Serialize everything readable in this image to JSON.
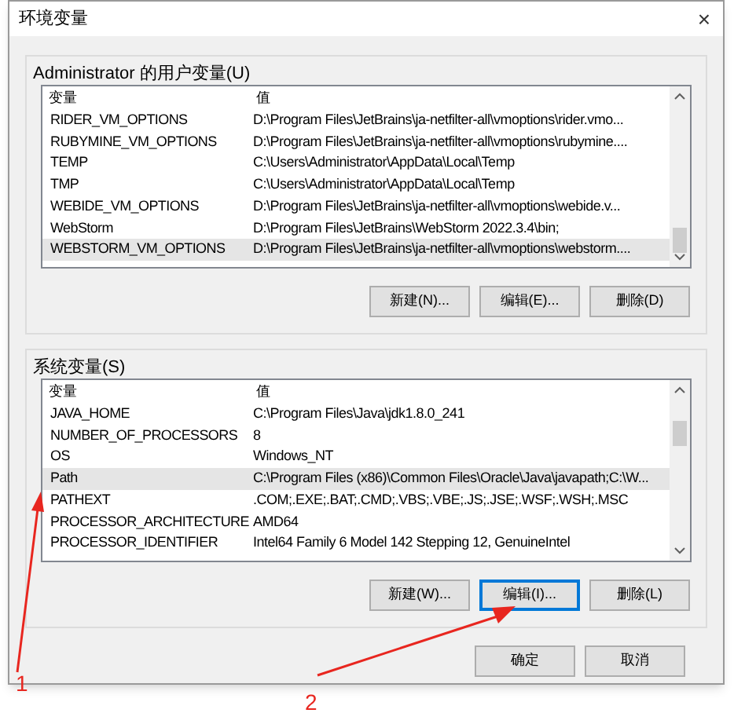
{
  "window": {
    "title": "环境变量",
    "close": "×"
  },
  "user_vars": {
    "label": "Administrator 的用户变量(U)",
    "columns": [
      "变量",
      "值"
    ],
    "rows": [
      {
        "name": "RIDER_VM_OPTIONS",
        "value": "D:\\Program Files\\JetBrains\\ja-netfilter-all\\vmoptions\\rider.vmo...",
        "selected": false
      },
      {
        "name": "RUBYMINE_VM_OPTIONS",
        "value": "D:\\Program Files\\JetBrains\\ja-netfilter-all\\vmoptions\\rubymine....",
        "selected": false
      },
      {
        "name": "TEMP",
        "value": "C:\\Users\\Administrator\\AppData\\Local\\Temp",
        "selected": false
      },
      {
        "name": "TMP",
        "value": "C:\\Users\\Administrator\\AppData\\Local\\Temp",
        "selected": false
      },
      {
        "name": "WEBIDE_VM_OPTIONS",
        "value": "D:\\Program Files\\JetBrains\\ja-netfilter-all\\vmoptions\\webide.v...",
        "selected": false
      },
      {
        "name": "WebStorm",
        "value": "D:\\Program Files\\JetBrains\\WebStorm 2022.3.4\\bin;",
        "selected": false
      },
      {
        "name": "WEBSTORM_VM_OPTIONS",
        "value": "D:\\Program Files\\JetBrains\\ja-netfilter-all\\vmoptions\\webstorm....",
        "selected": true
      }
    ],
    "buttons": [
      {
        "label": "新建(N)...",
        "focused": false
      },
      {
        "label": "编辑(E)...",
        "focused": false
      },
      {
        "label": "删除(D)",
        "focused": false
      }
    ]
  },
  "system_vars": {
    "label": "系统变量(S)",
    "columns": [
      "变量",
      "值"
    ],
    "rows": [
      {
        "name": "JAVA_HOME",
        "value": "C:\\Program Files\\Java\\jdk1.8.0_241",
        "selected": false
      },
      {
        "name": "NUMBER_OF_PROCESSORS",
        "value": "8",
        "selected": false
      },
      {
        "name": "OS",
        "value": "Windows_NT",
        "selected": false
      },
      {
        "name": "Path",
        "value": "C:\\Program Files (x86)\\Common Files\\Oracle\\Java\\javapath;C:\\W...",
        "selected": true
      },
      {
        "name": "PATHEXT",
        "value": ".COM;.EXE;.BAT;.CMD;.VBS;.VBE;.JS;.JSE;.WSF;.WSH;.MSC",
        "selected": false
      },
      {
        "name": "PROCESSOR_ARCHITECTURE",
        "value": "AMD64",
        "selected": false
      },
      {
        "name": "PROCESSOR_IDENTIFIER",
        "value": "Intel64 Family 6 Model 142 Stepping 12, GenuineIntel",
        "selected": false
      }
    ],
    "buttons": [
      {
        "label": "新建(W)...",
        "focused": false
      },
      {
        "label": "编辑(I)...",
        "focused": true
      },
      {
        "label": "删除(L)",
        "focused": false
      }
    ]
  },
  "dialog_buttons": [
    {
      "label": "确定"
    },
    {
      "label": "取消"
    }
  ],
  "annotations": [
    {
      "label": "1"
    },
    {
      "label": "2"
    }
  ]
}
